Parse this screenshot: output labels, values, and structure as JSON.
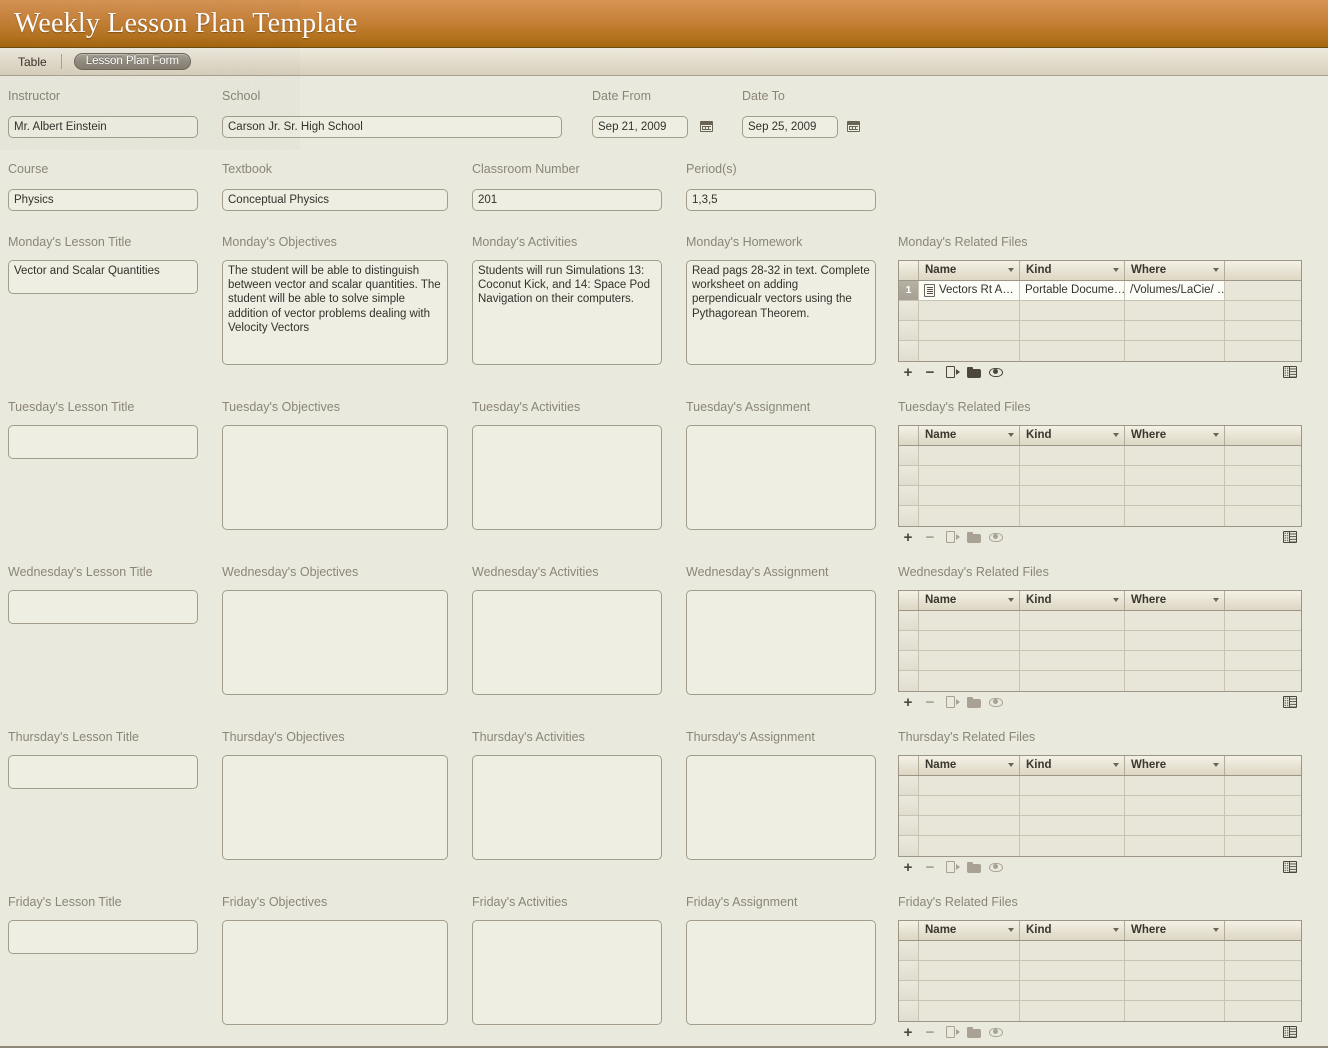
{
  "window": {
    "title": "Weekly Lesson Plan Template"
  },
  "tabbar": {
    "table_label": "Table",
    "active_tab_label": "Lesson Plan Form"
  },
  "colors": {
    "titlebar_top": "#d79454",
    "titlebar_bottom": "#a4660f",
    "page_background": "#e9e9dd",
    "label_text": "#8b8578",
    "field_text": "#33322d",
    "field_border": "#a49d8c"
  },
  "header_fields": [
    {
      "label": "Instructor",
      "value": "Mr. Albert Einstein",
      "name": "instructor"
    },
    {
      "label": "School",
      "value": "Carson Jr. Sr. High School",
      "name": "school"
    },
    {
      "label": "Date From",
      "value": "Sep 21, 2009",
      "name": "date-from"
    },
    {
      "label": "Date To",
      "value": "Sep 25, 2009",
      "name": "date-to"
    },
    {
      "label": "Course",
      "value": "Physics",
      "name": "course"
    },
    {
      "label": "Textbook",
      "value": "Conceptual Physics",
      "name": "textbook"
    },
    {
      "label": "Classroom Number",
      "value": "201",
      "name": "classroom-number"
    },
    {
      "label": "Period(s)",
      "value": "1,3,5",
      "name": "periods"
    }
  ],
  "files_table": {
    "columns": [
      "Name",
      "Kind",
      "Where"
    ],
    "row_count": 4,
    "toolbar_icons": [
      "add-icon",
      "remove-icon",
      "export-icon",
      "open-folder-icon",
      "preview-eye-icon"
    ],
    "view_toggle_icon": "view-toggle-icon"
  },
  "days": [
    {
      "key": "monday",
      "lesson_title_label": "Monday's Lesson Title",
      "objectives_label": "Monday's Objectives",
      "activities_label": "Monday's Activities",
      "assignment_label": "Monday's Homework",
      "files_label": "Monday's Related Files",
      "lesson_title_value": "Vector and Scalar Quantities",
      "objectives_value": "The student will be able to distinguish between vector and scalar quantities. The student will be able to solve simple addition of vector problems dealing with Velocity Vectors",
      "activities_value": "Students will run Simulations 13: Coconut Kick, and 14: Space Pod Navigation on their computers.",
      "assignment_value": "Read pags 28-32 in text. Complete worksheet on adding perpendicualr vectors using the Pythagorean Theorem.",
      "files": [
        {
          "index": "1",
          "name": "Vectors Rt A…",
          "kind": "Portable Docume…",
          "where": "/Volumes/LaCie/  …"
        }
      ],
      "has_files": true
    },
    {
      "key": "tuesday",
      "lesson_title_label": "Tuesday's Lesson Title",
      "objectives_label": "Tuesday's Objectives",
      "activities_label": "Tuesday's Activities",
      "assignment_label": "Tuesday's Assignment",
      "files_label": "Tuesday's Related Files",
      "lesson_title_value": "",
      "objectives_value": "",
      "activities_value": "",
      "assignment_value": "",
      "files": [],
      "has_files": false
    },
    {
      "key": "wednesday",
      "lesson_title_label": "Wednesday's Lesson Title",
      "objectives_label": "Wednesday's Objectives",
      "activities_label": "Wednesday's Activities",
      "assignment_label": "Wednesday's Assignment",
      "files_label": "Wednesday's Related Files",
      "lesson_title_value": "",
      "objectives_value": "",
      "activities_value": "",
      "assignment_value": "",
      "files": [],
      "has_files": false
    },
    {
      "key": "thursday",
      "lesson_title_label": "Thursday's Lesson Title",
      "objectives_label": "Thursday's Objectives",
      "activities_label": "Thursday's Activities",
      "assignment_label": "Thursday's Assignment",
      "files_label": "Thursday's Related Files",
      "lesson_title_value": "",
      "objectives_value": "",
      "activities_value": "",
      "assignment_value": "",
      "files": [],
      "has_files": false
    },
    {
      "key": "friday",
      "lesson_title_label": "Friday's Lesson Title",
      "objectives_label": "Friday's Objectives",
      "activities_label": "Friday's Activities",
      "assignment_label": "Friday's Assignment",
      "files_label": "Friday's Related Files",
      "lesson_title_value": "",
      "objectives_value": "",
      "activities_value": "",
      "assignment_value": "",
      "files": [],
      "has_files": false
    }
  ]
}
